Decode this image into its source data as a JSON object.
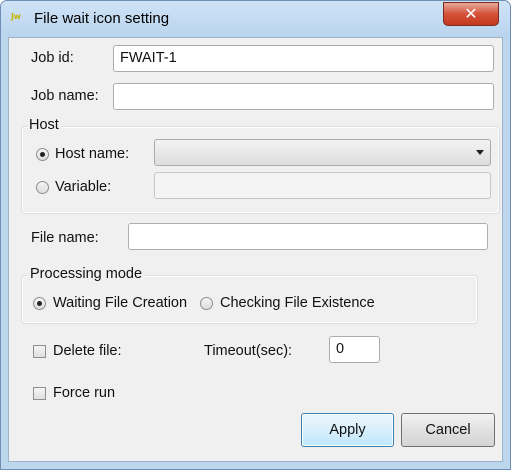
{
  "window": {
    "title": "File wait icon setting",
    "app_icon_text": "Jw",
    "close_symbol": "✕"
  },
  "job_id": {
    "label": "Job id:",
    "value": "FWAIT-1"
  },
  "job_name": {
    "label": "Job name:",
    "value": ""
  },
  "host": {
    "group_label": "Host",
    "host_name_label": "Host name:",
    "host_name_selected": "",
    "variable_label": "Variable:",
    "variable_value": "",
    "selected": "host_name"
  },
  "file_name": {
    "label": "File name:",
    "value": ""
  },
  "processing_mode": {
    "group_label": "Processing mode",
    "waiting_label": "Waiting File Creation",
    "checking_label": "Checking File Existence",
    "selected": "waiting"
  },
  "delete_file": {
    "label": "Delete file:",
    "checked": false
  },
  "timeout": {
    "label": "Timeout(sec):",
    "value": "0"
  },
  "force_run": {
    "label": "Force run",
    "checked": false
  },
  "buttons": {
    "apply": "Apply",
    "cancel": "Cancel"
  },
  "colors": {
    "titlebar": "#bcd6ee",
    "close_button": "#c4381f",
    "default_button_border": "#3c7fb1"
  }
}
